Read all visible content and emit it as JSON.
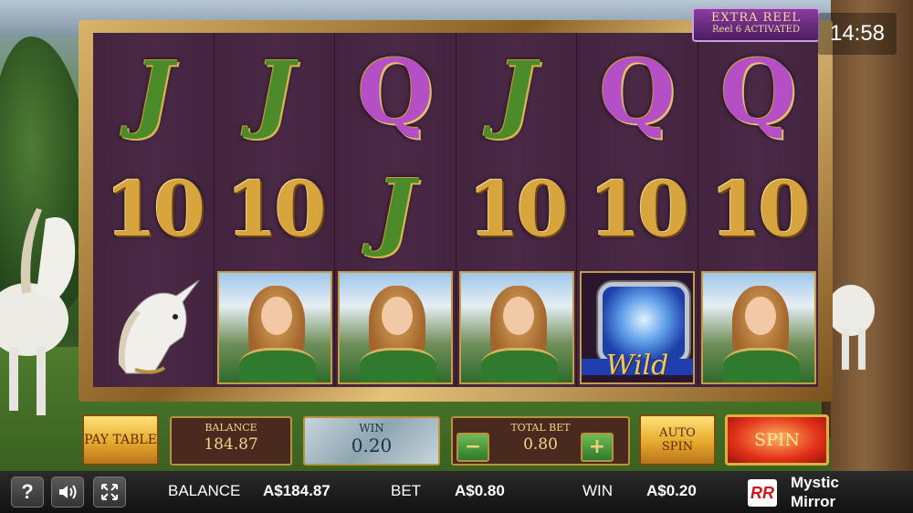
{
  "banner": {
    "extra_reel_title": "EXTRA REEL",
    "extra_reel_sub": "Reel 6 ACTIVATED"
  },
  "clock": "14:58",
  "reels": [
    [
      "J",
      "10",
      "unicorn"
    ],
    [
      "J",
      "10",
      "lady"
    ],
    [
      "Q",
      "J",
      "lady"
    ],
    [
      "J",
      "10",
      "lady"
    ],
    [
      "Q",
      "10",
      "wild"
    ],
    [
      "Q",
      "10",
      "lady"
    ]
  ],
  "wild_label": "Wild",
  "controls": {
    "pay_table": "PAY TABLE",
    "balance_label": "BALANCE",
    "balance_value": "184.87",
    "win_label": "WIN",
    "win_value": "0.20",
    "total_bet_label": "TOTAL BET",
    "total_bet_value": "0.80",
    "minus": "−",
    "plus": "+",
    "auto_spin": "AUTO SPIN",
    "spin": "SPIN"
  },
  "status_bar": {
    "help": "?",
    "balance_label": "BALANCE",
    "balance_value": "A$184.87",
    "bet_label": "BET",
    "bet_value": "A$0.80",
    "win_label": "WIN",
    "win_value": "A$0.20",
    "logo": "RR",
    "game_name_line1": "Mystic",
    "game_name_line2": "Mirror"
  },
  "colors": {
    "reel_bg": "#43243f",
    "frame_gold": "#c69b45",
    "spin_red": "#e2321a"
  }
}
